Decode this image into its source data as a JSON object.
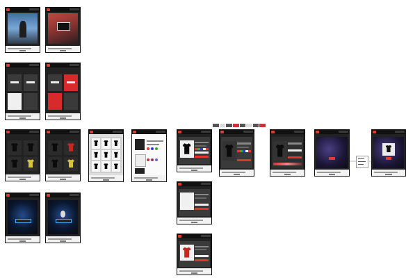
{
  "colors": {
    "brand": "#e53a2f",
    "dark_bg": "#222222",
    "nav_bg": "#111111",
    "footer_bg": "#f2f2f2"
  },
  "captions": {
    "c1": "1",
    "c2": "1a",
    "c3": "2",
    "c4": "2a",
    "c5": "3",
    "c6": "3a",
    "c7": "3b",
    "c8": "3c",
    "c9": "4",
    "c10": "4a",
    "c11": "5",
    "c12": "5a",
    "c13": "6",
    "c14": "7",
    "c15": "8",
    "c16": "9",
    "c17": "5b",
    "c18": "5c"
  },
  "popover": {
    "label": "Menu"
  }
}
